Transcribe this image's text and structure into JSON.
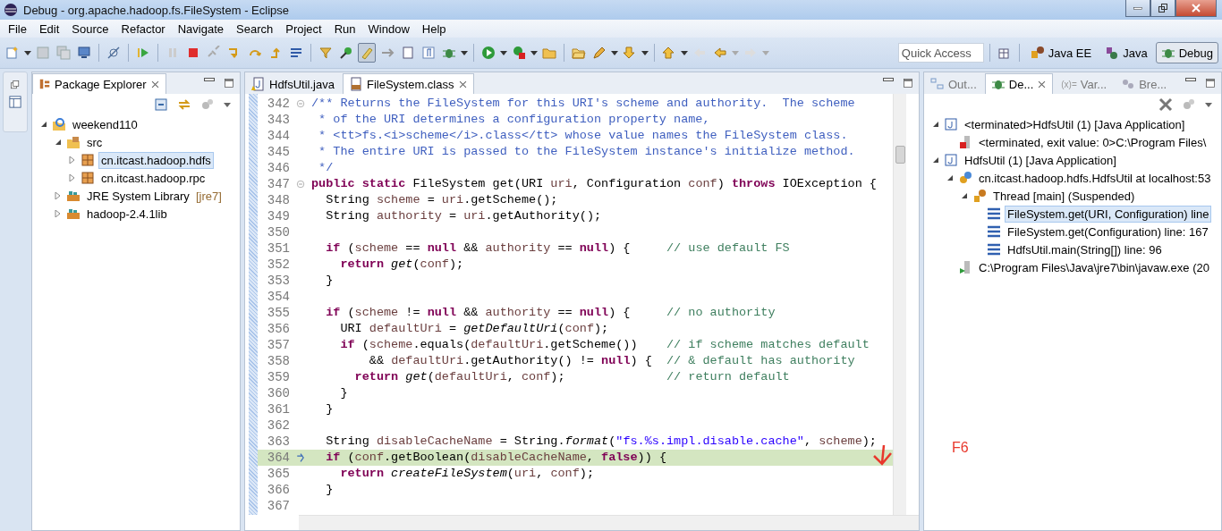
{
  "window": {
    "title": "Debug - org.apache.hadoop.fs.FileSystem - Eclipse"
  },
  "menu": [
    "File",
    "Edit",
    "Source",
    "Refactor",
    "Navigate",
    "Search",
    "Project",
    "Run",
    "Window",
    "Help"
  ],
  "quick_access": {
    "placeholder": "Quick Access"
  },
  "perspectives": [
    {
      "label": "Java EE",
      "kind": "javaee",
      "selected": false
    },
    {
      "label": "Java",
      "kind": "java",
      "selected": false
    },
    {
      "label": "Debug",
      "kind": "debug",
      "selected": true
    }
  ],
  "package_explorer": {
    "title": "Package Explorer",
    "tree": [
      {
        "label": "weekend110",
        "kind": "project",
        "expanded": true,
        "selected": false,
        "children": [
          {
            "label": "src",
            "kind": "source",
            "expanded": true,
            "selected": false,
            "children": [
              {
                "label": "cn.itcast.hadoop.hdfs",
                "kind": "package",
                "expanded": false,
                "selected": true
              },
              {
                "label": "cn.itcast.hadoop.rpc",
                "kind": "package",
                "expanded": false,
                "selected": false
              }
            ]
          },
          {
            "label": "JRE System Library",
            "decoration": "[jre7]",
            "kind": "library",
            "expanded": false,
            "selected": false
          },
          {
            "label": "hadoop-2.4.1lib",
            "kind": "library",
            "expanded": false,
            "selected": false
          }
        ]
      }
    ]
  },
  "editor": {
    "tabs": [
      {
        "label": "HdfsUtil.java",
        "kind": "java",
        "selected": false
      },
      {
        "label": "FileSystem.class",
        "kind": "class",
        "selected": true
      }
    ],
    "lines": [
      {
        "number": "342",
        "fold": true,
        "current": false,
        "tokens": [
          {
            "kind": "comment",
            "text": "/** Returns the FileSystem for this URI's scheme and authority.  The scheme"
          }
        ]
      },
      {
        "number": "343",
        "fold": false,
        "current": false,
        "tokens": [
          {
            "kind": "comment",
            "text": " * of the URI determines a configuration property name,"
          }
        ]
      },
      {
        "number": "344",
        "fold": false,
        "current": false,
        "tokens": [
          {
            "kind": "comment",
            "text": " * <tt>fs.<i>scheme</i>.class</tt> whose value names the FileSystem class."
          }
        ]
      },
      {
        "number": "345",
        "fold": false,
        "current": false,
        "tokens": [
          {
            "kind": "comment",
            "text": " * The entire URI is passed to the FileSystem instance's initialize method."
          }
        ]
      },
      {
        "number": "346",
        "fold": false,
        "current": false,
        "tokens": [
          {
            "kind": "comment",
            "text": " */"
          }
        ]
      },
      {
        "number": "347",
        "fold": true,
        "current": false,
        "tokens": [
          {
            "kind": "keyword",
            "text": "public static "
          },
          {
            "kind": "plain",
            "text": "FileSystem get(URI "
          },
          {
            "kind": "variable",
            "text": "uri"
          },
          {
            "kind": "plain",
            "text": ", Configuration "
          },
          {
            "kind": "variable",
            "text": "conf"
          },
          {
            "kind": "plain",
            "text": ") "
          },
          {
            "kind": "keyword",
            "text": "throws"
          },
          {
            "kind": "plain",
            "text": " IOException {"
          }
        ]
      },
      {
        "number": "348",
        "fold": false,
        "current": false,
        "tokens": [
          {
            "kind": "plain",
            "text": "  String "
          },
          {
            "kind": "variable",
            "text": "scheme"
          },
          {
            "kind": "plain",
            "text": " = "
          },
          {
            "kind": "variable",
            "text": "uri"
          },
          {
            "kind": "plain",
            "text": ".getScheme();"
          }
        ]
      },
      {
        "number": "349",
        "fold": false,
        "current": false,
        "tokens": [
          {
            "kind": "plain",
            "text": "  String "
          },
          {
            "kind": "variable",
            "text": "authority"
          },
          {
            "kind": "plain",
            "text": " = "
          },
          {
            "kind": "variable",
            "text": "uri"
          },
          {
            "kind": "plain",
            "text": ".getAuthority();"
          }
        ]
      },
      {
        "number": "350",
        "fold": false,
        "current": false
      },
      {
        "number": "351",
        "fold": false,
        "current": false,
        "tokens": [
          {
            "kind": "keyword",
            "text": "  if"
          },
          {
            "kind": "plain",
            "text": " ("
          },
          {
            "kind": "variable",
            "text": "scheme"
          },
          {
            "kind": "plain",
            "text": " == "
          },
          {
            "kind": "keyword",
            "text": "null"
          },
          {
            "kind": "plain",
            "text": " && "
          },
          {
            "kind": "variable",
            "text": "authority"
          },
          {
            "kind": "plain",
            "text": " == "
          },
          {
            "kind": "keyword",
            "text": "null"
          },
          {
            "kind": "plain",
            "text": ") {     "
          },
          {
            "kind": "line-comment",
            "text": "// use default FS"
          }
        ]
      },
      {
        "number": "352",
        "fold": false,
        "current": false,
        "tokens": [
          {
            "kind": "keyword",
            "text": "    return"
          },
          {
            "kind": "static-call",
            "text": " get"
          },
          {
            "kind": "plain",
            "text": "("
          },
          {
            "kind": "variable",
            "text": "conf"
          },
          {
            "kind": "plain",
            "text": ");"
          }
        ]
      },
      {
        "number": "353",
        "fold": false,
        "current": false,
        "tokens": [
          {
            "kind": "plain",
            "text": "  }"
          }
        ]
      },
      {
        "number": "354",
        "fold": false,
        "current": false
      },
      {
        "number": "355",
        "fold": false,
        "current": false,
        "tokens": [
          {
            "kind": "keyword",
            "text": "  if"
          },
          {
            "kind": "plain",
            "text": " ("
          },
          {
            "kind": "variable",
            "text": "scheme"
          },
          {
            "kind": "plain",
            "text": " != "
          },
          {
            "kind": "keyword",
            "text": "null"
          },
          {
            "kind": "plain",
            "text": " && "
          },
          {
            "kind": "variable",
            "text": "authority"
          },
          {
            "kind": "plain",
            "text": " == "
          },
          {
            "kind": "keyword",
            "text": "null"
          },
          {
            "kind": "plain",
            "text": ") {     "
          },
          {
            "kind": "line-comment",
            "text": "// no authority"
          }
        ]
      },
      {
        "number": "356",
        "fold": false,
        "current": false,
        "tokens": [
          {
            "kind": "plain",
            "text": "    URI "
          },
          {
            "kind": "variable",
            "text": "defaultUri"
          },
          {
            "kind": "plain",
            "text": " = "
          },
          {
            "kind": "static-call",
            "text": "getDefaultUri"
          },
          {
            "kind": "plain",
            "text": "("
          },
          {
            "kind": "variable",
            "text": "conf"
          },
          {
            "kind": "plain",
            "text": ");"
          }
        ]
      },
      {
        "number": "357",
        "fold": false,
        "current": false,
        "tokens": [
          {
            "kind": "keyword",
            "text": "    if"
          },
          {
            "kind": "plain",
            "text": " ("
          },
          {
            "kind": "variable",
            "text": "scheme"
          },
          {
            "kind": "plain",
            "text": ".equals("
          },
          {
            "kind": "variable",
            "text": "defaultUri"
          },
          {
            "kind": "plain",
            "text": ".getScheme())    "
          },
          {
            "kind": "line-comment",
            "text": "// if scheme matches default"
          }
        ]
      },
      {
        "number": "358",
        "fold": false,
        "current": false,
        "tokens": [
          {
            "kind": "plain",
            "text": "        && "
          },
          {
            "kind": "variable",
            "text": "defaultUri"
          },
          {
            "kind": "plain",
            "text": ".getAuthority() != "
          },
          {
            "kind": "keyword",
            "text": "null"
          },
          {
            "kind": "plain",
            "text": ") {  "
          },
          {
            "kind": "line-comment",
            "text": "// & default has authority"
          }
        ]
      },
      {
        "number": "359",
        "fold": false,
        "current": false,
        "tokens": [
          {
            "kind": "keyword",
            "text": "      return"
          },
          {
            "kind": "static-call",
            "text": " get"
          },
          {
            "kind": "plain",
            "text": "("
          },
          {
            "kind": "variable",
            "text": "defaultUri"
          },
          {
            "kind": "plain",
            "text": ", "
          },
          {
            "kind": "variable",
            "text": "conf"
          },
          {
            "kind": "plain",
            "text": ");              "
          },
          {
            "kind": "line-comment",
            "text": "// return default"
          }
        ]
      },
      {
        "number": "360",
        "fold": false,
        "current": false,
        "tokens": [
          {
            "kind": "plain",
            "text": "    }"
          }
        ]
      },
      {
        "number": "361",
        "fold": false,
        "current": false,
        "tokens": [
          {
            "kind": "plain",
            "text": "  }"
          }
        ]
      },
      {
        "number": "362",
        "fold": false,
        "current": false
      },
      {
        "number": "363",
        "fold": false,
        "current": false,
        "tokens": [
          {
            "kind": "plain",
            "text": "  String "
          },
          {
            "kind": "variable",
            "text": "disableCacheName"
          },
          {
            "kind": "plain",
            "text": " = String."
          },
          {
            "kind": "static-call",
            "text": "format"
          },
          {
            "kind": "plain",
            "text": "("
          },
          {
            "kind": "string",
            "text": "\"fs.%s.impl.disable.cache\""
          },
          {
            "kind": "plain",
            "text": ", "
          },
          {
            "kind": "variable",
            "text": "scheme"
          },
          {
            "kind": "plain",
            "text": ");"
          }
        ]
      },
      {
        "number": "364",
        "fold": false,
        "current": true,
        "tokens": [
          {
            "kind": "keyword",
            "text": "  if"
          },
          {
            "kind": "plain",
            "text": " ("
          },
          {
            "kind": "variable",
            "text": "conf"
          },
          {
            "kind": "plain",
            "text": ".getBoolean("
          },
          {
            "kind": "variable",
            "text": "disableCacheName"
          },
          {
            "kind": "plain",
            "text": ", "
          },
          {
            "kind": "keyword",
            "text": "false"
          },
          {
            "kind": "plain",
            "text": ")) {"
          }
        ]
      },
      {
        "number": "365",
        "fold": false,
        "current": false,
        "tokens": [
          {
            "kind": "keyword",
            "text": "    return"
          },
          {
            "kind": "static-call",
            "text": " createFileSystem"
          },
          {
            "kind": "plain",
            "text": "("
          },
          {
            "kind": "variable",
            "text": "uri"
          },
          {
            "kind": "plain",
            "text": ", "
          },
          {
            "kind": "variable",
            "text": "conf"
          },
          {
            "kind": "plain",
            "text": ");"
          }
        ]
      },
      {
        "number": "366",
        "fold": false,
        "current": false,
        "tokens": [
          {
            "kind": "plain",
            "text": "  }"
          }
        ]
      },
      {
        "number": "367",
        "fold": false,
        "current": false
      }
    ]
  },
  "debug_view": {
    "tabs": [
      {
        "label": "Out...",
        "kind": "outline",
        "selected": false
      },
      {
        "label": "De...",
        "kind": "debug",
        "selected": true
      },
      {
        "label": "Var...",
        "icon_text": "(x)=",
        "kind": "variables",
        "selected": false
      },
      {
        "label": "Bre...",
        "kind": "breakpoints",
        "selected": false
      }
    ],
    "tree": [
      {
        "label": "<terminated>HdfsUtil (1) [Java Application]",
        "kind": "launch",
        "expanded": true,
        "selected": false,
        "children": [
          {
            "label": "<terminated, exit value: 0>C:\\Program Files\\",
            "kind": "dead-process",
            "selected": false
          }
        ]
      },
      {
        "label": "HdfsUtil (1) [Java Application]",
        "kind": "launch",
        "expanded": true,
        "selected": false,
        "children": [
          {
            "label": "cn.itcast.hadoop.hdfs.HdfsUtil at localhost:53",
            "kind": "target",
            "expanded": true,
            "selected": false,
            "children": [
              {
                "label": "Thread [main] (Suspended)",
                "kind": "thread",
                "expanded": true,
                "selected": false,
                "children": [
                  {
                    "label": "FileSystem.get(URI, Configuration) line",
                    "kind": "frame",
                    "selected": true
                  },
                  {
                    "label": "FileSystem.get(Configuration) line: 167",
                    "kind": "frame",
                    "selected": false
                  },
                  {
                    "label": "HdfsUtil.main(String[]) line: 96",
                    "kind": "frame",
                    "selected": false
                  }
                ]
              }
            ]
          },
          {
            "label": "C:\\Program Files\\Java\\jre7\\bin\\javaw.exe (20",
            "kind": "process",
            "selected": false
          }
        ]
      }
    ]
  },
  "annotation": {
    "text": "F6"
  }
}
